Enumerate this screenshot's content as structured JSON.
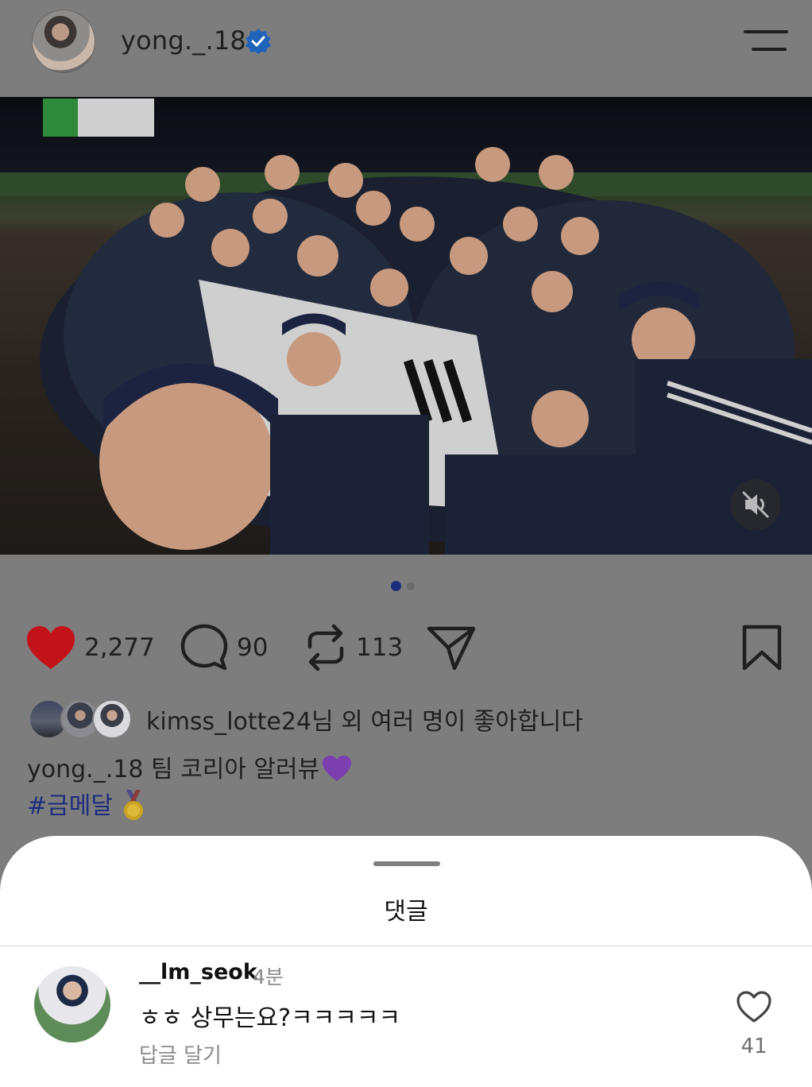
{
  "post": {
    "username": "yong._.18",
    "verified": true,
    "icons": {
      "verified": "verified-badge-icon",
      "menu": "menu-icon",
      "mute": "mute-icon"
    },
    "carousel": {
      "current": 1,
      "total": 2
    },
    "actions": {
      "likes": "2,277",
      "comments": "90",
      "reposts": "113"
    },
    "liked_by": {
      "user": "kimss_lotte24",
      "suffix": "님 외 여러 명이 좋아합니다"
    },
    "caption": {
      "username": "yong._.18",
      "text": " 팀 코리아 알러뷰",
      "hashtag": "#금메달"
    },
    "colors": {
      "like": "#c4121a",
      "accent": "#1d2c7c",
      "verified": "#1f64b8"
    }
  },
  "comments_sheet": {
    "title": "댓글",
    "comments": [
      {
        "user": "__lm_seok",
        "time": "4분",
        "text": "ㅎㅎ 상무는요?ㅋㅋㅋㅋㅋ",
        "reply_label": "답글 달기",
        "likes": "41"
      }
    ]
  }
}
